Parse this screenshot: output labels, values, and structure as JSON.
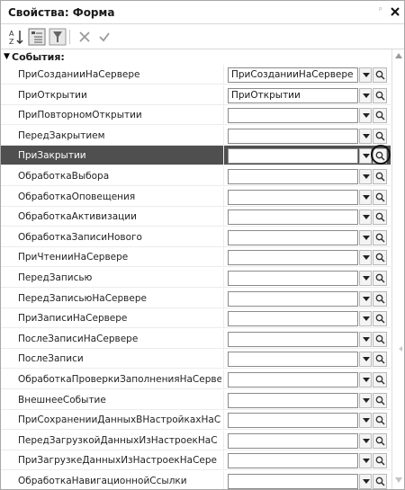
{
  "window": {
    "title": "Свойства: Форма",
    "pin_glyph": "ᵖ"
  },
  "toolbar": {
    "sort_icon": "sort-alphabetical-icon",
    "categories_icon": "categories-icon",
    "filter_icon": "filter-icon",
    "clear_icon": "clear-icon",
    "apply_icon": "apply-icon"
  },
  "section": {
    "label": "События:"
  },
  "rows": [
    {
      "name": "ПриСозданииНаСервере",
      "value": "ПриСозданииНаСервере"
    },
    {
      "name": "ПриОткрытии",
      "value": "ПриОткрытии"
    },
    {
      "name": "ПриПовторномОткрытии",
      "value": ""
    },
    {
      "name": "ПередЗакрытием",
      "value": ""
    },
    {
      "name": "ПриЗакрытии",
      "value": ""
    },
    {
      "name": "ОбработкаВыбора",
      "value": ""
    },
    {
      "name": "ОбработкаОповещения",
      "value": ""
    },
    {
      "name": "ОбработкаАктивизации",
      "value": ""
    },
    {
      "name": "ОбработкаЗаписиНового",
      "value": ""
    },
    {
      "name": "ПриЧтенииНаСервере",
      "value": ""
    },
    {
      "name": "ПередЗаписью",
      "value": ""
    },
    {
      "name": "ПередЗаписьюНаСервере",
      "value": ""
    },
    {
      "name": "ПриЗаписиНаСервере",
      "value": ""
    },
    {
      "name": "ПослеЗаписиНаСервере",
      "value": ""
    },
    {
      "name": "ПослеЗаписи",
      "value": ""
    },
    {
      "name": "ОбработкаПроверкиЗаполненияНаСерве",
      "value": ""
    },
    {
      "name": "ВнешнееСобытие",
      "value": ""
    },
    {
      "name": "ПриСохраненииДанныхВНастройкахНаС",
      "value": ""
    },
    {
      "name": "ПередЗагрузкойДанныхИзНастроекНаС",
      "value": ""
    },
    {
      "name": "ПриЗагрузкеДанныхИзНастроекНаСере",
      "value": ""
    },
    {
      "name": "ОбработкаНавигационнойСсылки",
      "value": ""
    }
  ],
  "selected_row": 4,
  "colors": {
    "selected_row": "#4f4f4f",
    "border": "#8a8a8a"
  }
}
